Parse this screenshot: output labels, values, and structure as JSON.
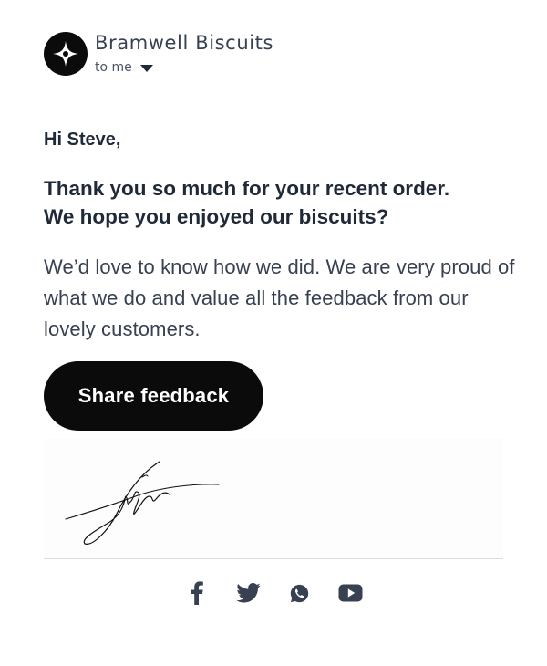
{
  "sender": {
    "name": "Bramwell Biscuits",
    "recipient_label": "to me",
    "avatar_icon": "four-point-star-icon"
  },
  "message": {
    "greeting": "Hi Steve,",
    "headline_line1": "Thank you so much for your recent order.",
    "headline_line2": "We hope you enjoyed our biscuits?",
    "paragraph": "We’d love to know how we did. We are very proud of what we do and value all the feedback from our lovely customers.",
    "cta_label": "Share feedback"
  },
  "signature": {
    "type": "handwritten-signature"
  },
  "social_links": [
    {
      "icon": "facebook-icon"
    },
    {
      "icon": "twitter-icon"
    },
    {
      "icon": "whatsapp-icon"
    },
    {
      "icon": "youtube-icon"
    }
  ],
  "colors": {
    "button_bg": "#0b0b0b",
    "button_text": "#ffffff",
    "text": "#1f2937",
    "icon": "#374151",
    "divider": "#d9dce1"
  }
}
